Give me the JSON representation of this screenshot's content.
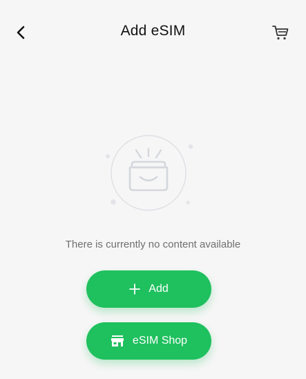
{
  "header": {
    "title": "Add eSIM",
    "back_icon": "chevron-left-icon",
    "cart_icon": "cart-icon"
  },
  "empty_state": {
    "illustration_icon": "empty-inbox-icon",
    "message": "There is currently no content available"
  },
  "actions": {
    "add_label": "Add",
    "add_icon": "plus-icon",
    "shop_label": "eSIM Shop",
    "shop_icon": "store-icon"
  },
  "colors": {
    "accent": "#1fc05e",
    "background": "#f6f6f6",
    "text_primary": "#111111",
    "text_secondary": "#6f6f6f"
  }
}
